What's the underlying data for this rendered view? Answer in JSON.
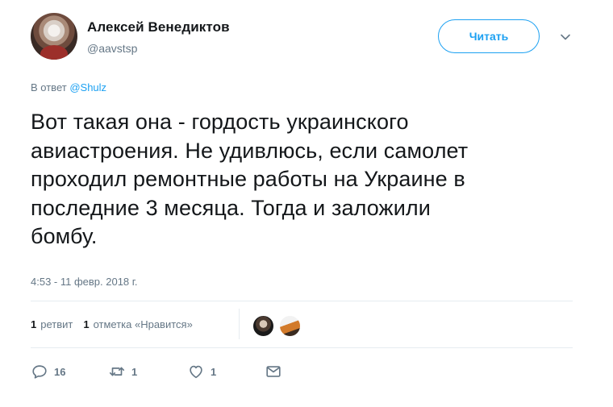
{
  "author": {
    "display_name": "Алексей Венедиктов",
    "username": "@aavstsp"
  },
  "follow_button": {
    "label": "Читать"
  },
  "reply_context": {
    "prefix": "В ответ",
    "mention": "@Shulz"
  },
  "tweet": {
    "text": "Вот такая она - гордость украинского\nавиастроения. Не удивлюсь, если самолет\nпроходил ремонтные работы на Украине в\nпоследние 3 месяца. Тогда и заложили\nбомбу.",
    "timestamp": "4:53 - 11 февр. 2018 г."
  },
  "stats": {
    "retweet_count": "1",
    "retweet_label": "ретвит",
    "like_count": "1",
    "like_label": "отметка «Нравится»"
  },
  "actions": {
    "reply_count": "16",
    "retweet_count": "1",
    "like_count": "1"
  },
  "icons": {
    "reply": "reply-icon",
    "retweet": "retweet-icon",
    "like": "heart-icon",
    "dm": "envelope-icon",
    "caret": "chevron-down-icon"
  },
  "colors": {
    "accent": "#1da1f2",
    "secondary_text": "#657786",
    "primary_text": "#14171a",
    "divider": "#e6ecf0"
  }
}
